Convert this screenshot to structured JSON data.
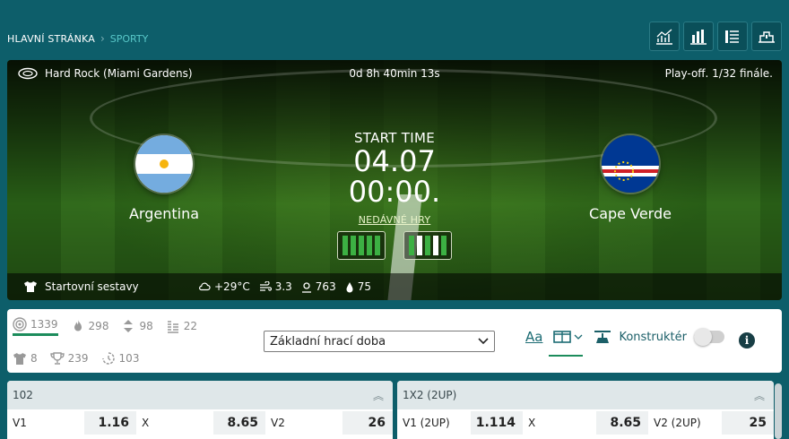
{
  "breadcrumb": {
    "home": "HLAVNÍ STRÁNKA",
    "separator": "›",
    "current": "SPORTY"
  },
  "view_buttons": [
    "stats-chart-icon",
    "bar-chart-icon",
    "list-view-icon",
    "lineup-icon"
  ],
  "hero": {
    "stadium": "Hard Rock (Miami Gardens)",
    "countdown": "0d 8h 40min 13s",
    "stage": "Play-off. 1/32 finále.",
    "start_label": "START TIME",
    "start_time": "04.07 00:00.",
    "recent_games": "NEDÁVNÉ HRY",
    "home": {
      "name": "Argentina",
      "form": [
        "win",
        "win",
        "win",
        "win",
        "win"
      ]
    },
    "away": {
      "name": "Cape Verde",
      "form": [
        "win",
        "draw",
        "win",
        "draw",
        "win"
      ]
    },
    "lineups": "Startovní sestavy",
    "weather": {
      "temperature": "+29°C",
      "wind": "3.3",
      "pressure": "763",
      "humidity": "75"
    }
  },
  "stats": {
    "row1": [
      {
        "icon": "target-icon",
        "value": "1339"
      },
      {
        "icon": "fire-icon",
        "value": "298"
      },
      {
        "icon": "updown-icon",
        "value": "98"
      },
      {
        "icon": "bars-icon",
        "value": "22"
      }
    ],
    "row2": [
      {
        "icon": "shirt-icon",
        "value": "8"
      },
      {
        "icon": "trophy-icon",
        "value": "239"
      },
      {
        "icon": "timer-icon",
        "value": "103"
      }
    ]
  },
  "period_select": {
    "value": "Základní hrací doba"
  },
  "tools": {
    "font_label": "Aa",
    "konstruktor": "Konstruktér"
  },
  "markets": [
    {
      "title": "102",
      "odds": [
        {
          "label": "V1",
          "value": "1.16"
        },
        {
          "label": "X",
          "value": "8.65"
        },
        {
          "label": "V2",
          "value": "26"
        }
      ]
    },
    {
      "title": "1X2 (2UP)",
      "odds": [
        {
          "label": "V1 (2UP)",
          "value": "1.114"
        },
        {
          "label": "X",
          "value": "8.65"
        },
        {
          "label": "V2 (2UP)",
          "value": "25"
        }
      ]
    }
  ],
  "colors": {
    "page_bg": "#0d5e6a",
    "accent_green": "#1c8c5c",
    "form_win": "#3cb043",
    "form_draw": "#ffffff"
  }
}
